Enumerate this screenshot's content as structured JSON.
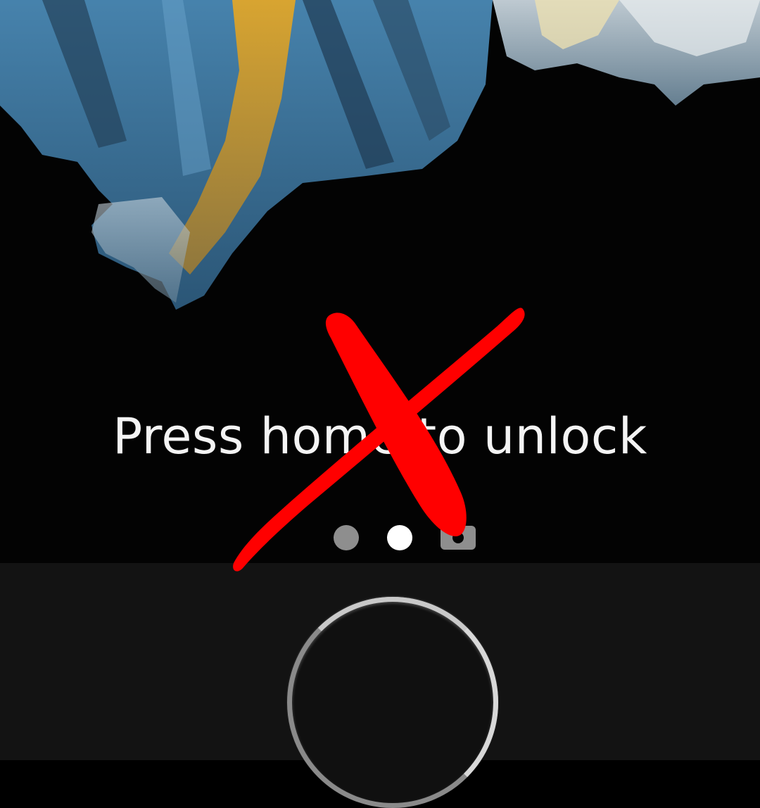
{
  "lock_screen": {
    "unlock_hint": "Press home to unlock",
    "page_indicator": {
      "dots": [
        {
          "state": "inactive",
          "color": "#8e8e8e"
        },
        {
          "state": "active",
          "color": "#ffffff"
        }
      ],
      "camera_icon": "camera-icon",
      "camera_color": "#8e8e8e"
    }
  },
  "device": {
    "home_button_icon": "home-button"
  },
  "annotation": {
    "icon": "red-cross-mark-icon",
    "color": "#ff0000"
  }
}
